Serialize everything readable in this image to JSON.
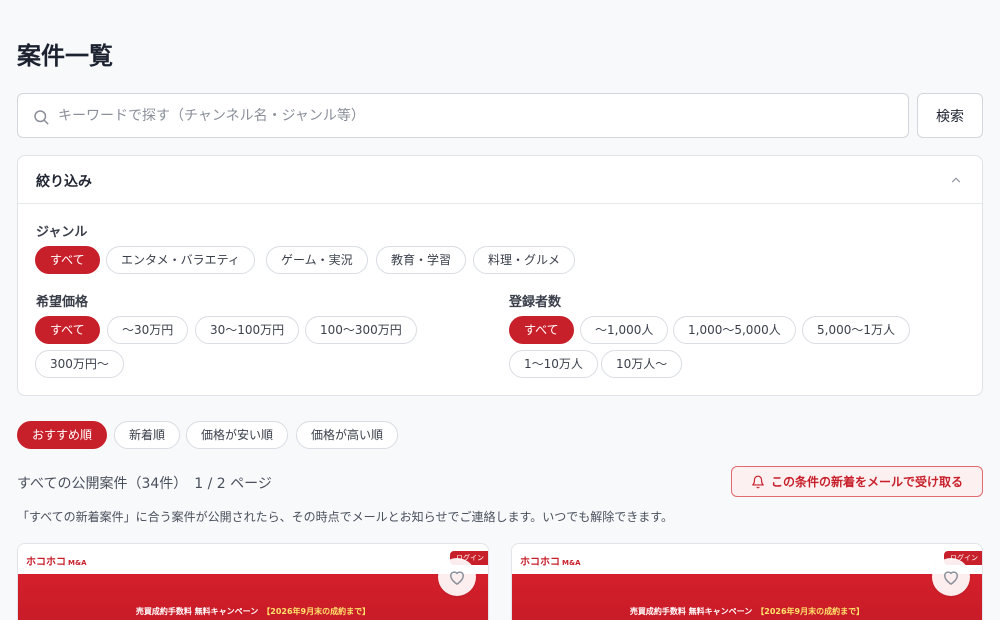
{
  "page": {
    "title": "案件一覧"
  },
  "search": {
    "placeholder": "キーワードで探す（チャンネル名・ジャンル等）",
    "value": "",
    "button_label": "検索"
  },
  "filter": {
    "title": "絞り込み",
    "genre": {
      "label": "ジャンル",
      "options": [
        "すべて",
        "エンタメ・バラエティ",
        "ゲーム・実況",
        "教育・学習",
        "料理・グルメ"
      ],
      "selected": "すべて"
    },
    "price": {
      "label": "希望価格",
      "options": [
        "すべて",
        "〜30万円",
        "30〜100万円",
        "100〜300万円",
        "300万円〜"
      ],
      "selected": "すべて"
    },
    "subscribers": {
      "label": "登録者数",
      "options": [
        "すべて",
        "〜1,000人",
        "1,000〜5,000人",
        "5,000〜1万人",
        "1〜10万人",
        "10万人〜"
      ],
      "selected": "すべて"
    }
  },
  "sort": {
    "options": [
      "おすすめ順",
      "新着順",
      "価格が安い順",
      "価格が高い順"
    ],
    "selected": "おすすめ順"
  },
  "results": {
    "summary": "すべての公開案件（34件）　1 / 2 ページ",
    "notify_button_label": "この条件の新着をメールで受け取る",
    "notify_description": "「すべての新着案件」に合う案件が公開されたら、その時点でメールとお知らせでご連絡します。いつでも解除できます。"
  },
  "cards": [
    {
      "logo": "ホコホコ",
      "logo_suffix": "M&A",
      "tag": "ログイン",
      "banner_text": "売買成約手数料 無料キャンペーン",
      "banner_accent": "【2026年9月末の成約まで】"
    },
    {
      "logo": "ホコホコ",
      "logo_suffix": "M&A",
      "tag": "ログイン",
      "banner_text": "売買成約手数料 無料キャンペーン",
      "banner_accent": "【2026年9月末の成約まで】"
    }
  ],
  "colors": {
    "accent": "#c8202b",
    "background": "#f8f9fb",
    "border": "#d3d6dc"
  }
}
